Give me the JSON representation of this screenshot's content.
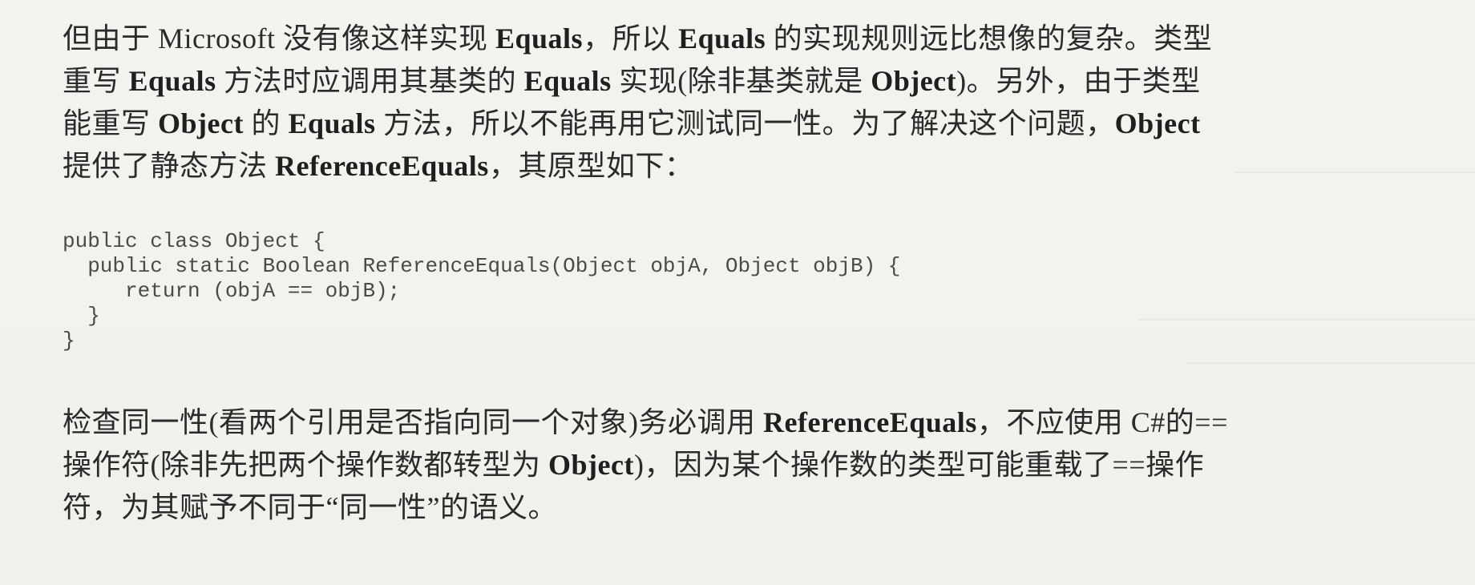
{
  "paragraph1": {
    "lines": [
      [
        {
          "t": "但由于 Microsoft 没有像这样实现 ",
          "b": false
        },
        {
          "t": "Equals",
          "b": true
        },
        {
          "t": "，所以 ",
          "b": false
        },
        {
          "t": "Equals",
          "b": true
        },
        {
          "t": " 的实现规则远比想像的复杂。类型",
          "b": false
        }
      ],
      [
        {
          "t": "重写 ",
          "b": false
        },
        {
          "t": "Equals",
          "b": true
        },
        {
          "t": " 方法时应调用其基类的 ",
          "b": false
        },
        {
          "t": "Equals",
          "b": true
        },
        {
          "t": " 实现(除非基类就是 ",
          "b": false
        },
        {
          "t": "Object",
          "b": true
        },
        {
          "t": ")。另外，由于类型",
          "b": false
        }
      ],
      [
        {
          "t": "能重写 ",
          "b": false
        },
        {
          "t": "Object",
          "b": true
        },
        {
          "t": " 的 ",
          "b": false
        },
        {
          "t": "Equals",
          "b": true
        },
        {
          "t": " 方法，所以不能再用它测试同一性。为了解决这个问题，",
          "b": false
        },
        {
          "t": "Object",
          "b": true
        }
      ],
      [
        {
          "t": "提供了静态方法 ",
          "b": false
        },
        {
          "t": "ReferenceEquals",
          "b": true
        },
        {
          "t": "，其原型如下：",
          "b": false
        }
      ]
    ]
  },
  "code": {
    "lines": [
      "public class Object {",
      "  public static Boolean ReferenceEquals(Object objA, Object objB) {",
      "     return (objA == objB);",
      "  }",
      "}"
    ]
  },
  "paragraph2": {
    "lines": [
      [
        {
          "t": "检查同一性(看两个引用是否指向同一个对象)务必调用 ",
          "b": false
        },
        {
          "t": "ReferenceEquals",
          "b": true
        },
        {
          "t": "，不应使用 C#的==",
          "b": false
        }
      ],
      [
        {
          "t": "操作符(除非先把两个操作数都转型为 ",
          "b": false
        },
        {
          "t": "Object",
          "b": true
        },
        {
          "t": ")，因为某个操作数的类型可能重载了==操作",
          "b": false
        }
      ],
      [
        {
          "t": "符，为其赋予不同于“同一性”的语义。",
          "b": false
        }
      ]
    ]
  }
}
